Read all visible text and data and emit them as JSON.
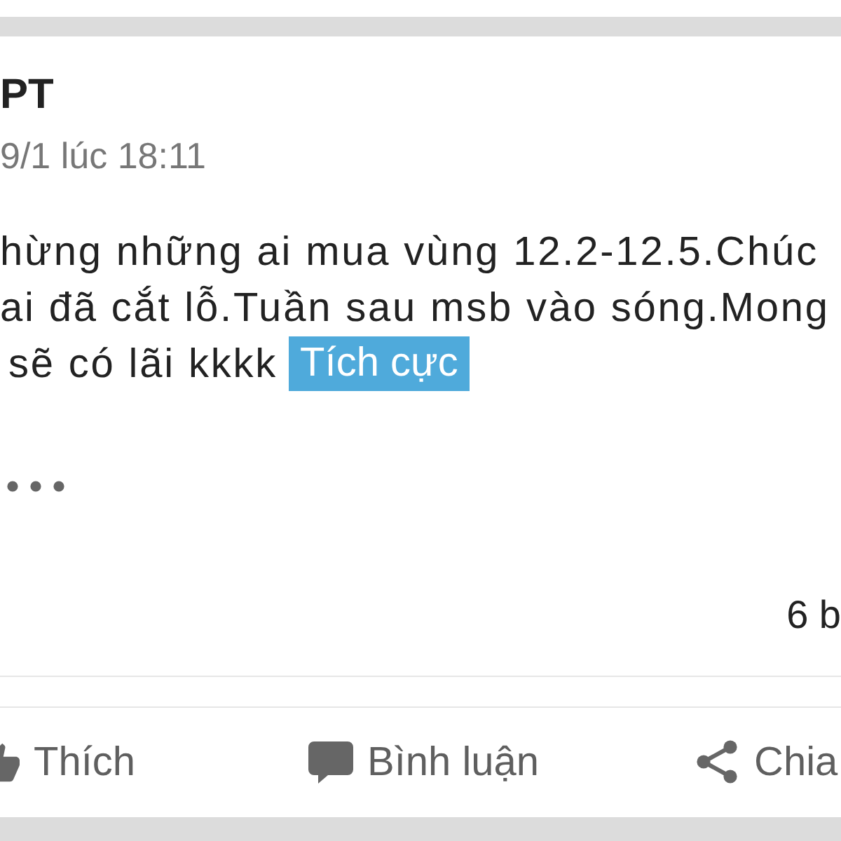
{
  "post": {
    "author": "PT",
    "timestamp": "9/1 lúc 18:11",
    "body_lines": [
      "hừng những ai mua vùng 12.2-12.5.Chúc",
      "ai đã cắt lỗ.Tuần sau msb vào sóng.Mong",
      "sẽ có lãi kkkk"
    ],
    "sentiment_tag": "Tích cực",
    "comment_count": "6 b"
  },
  "actions": [
    {
      "kind": "like",
      "label": "Thích"
    },
    {
      "kind": "comment",
      "label": "Bình luận"
    },
    {
      "kind": "share",
      "label": "Chia"
    }
  ]
}
